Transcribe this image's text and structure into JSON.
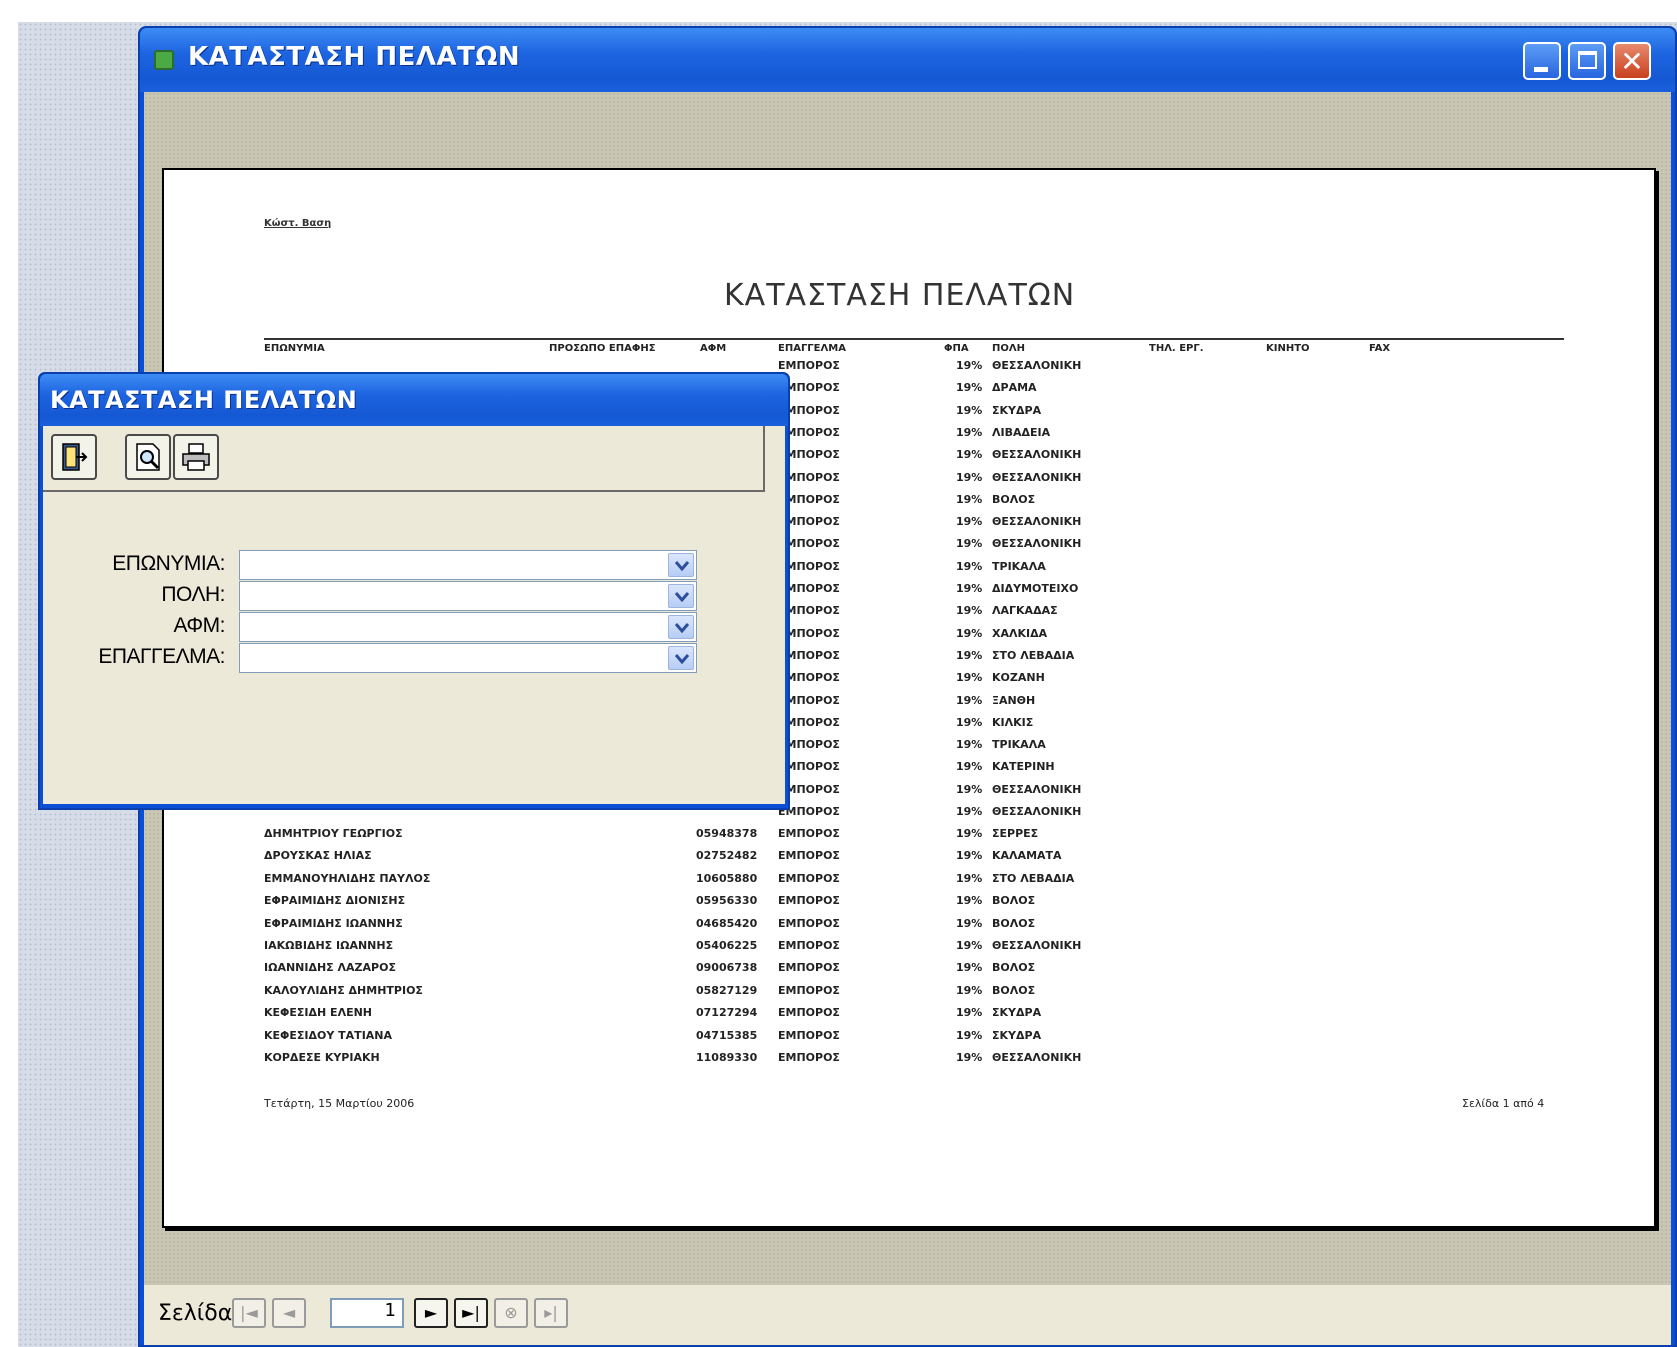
{
  "main_window": {
    "title": "ΚΑΤΑΣΤΑΣΗ ΠΕΛΑΤΩΝ",
    "controls": {
      "minimize": "minimize",
      "maximize": "maximize",
      "close": "✕"
    }
  },
  "report": {
    "tag": "Κώστ. Βαση",
    "title": "ΚΑΤΑΣΤΑΣΗ ΠΕΛΑΤΩΝ",
    "columns": [
      "ΕΠΩΝΥΜΙΑ",
      "ΠΡΟΣΩΠΟ ΕΠΑΦΗΣ",
      "ΑΦΜ",
      "ΕΠΑΓΓΕΛΜΑ",
      "ΦΠΑ",
      "ΠΟΛΗ",
      "ΤΗΛ. ΕΡΓ.",
      "ΚΙΝΗΤΟ",
      "FAX"
    ],
    "rows_visible_behind_dialog": [
      {
        "epaggelma": "ΕΜΠΟΡΟΣ",
        "fpa": "19%",
        "poli": "ΘΕΣΣΑΛΟΝΙΚΗ"
      },
      {
        "epaggelma": "ΕΜΠΟΡΟΣ",
        "fpa": "19%",
        "poli": "ΔΡΑΜΑ"
      },
      {
        "epaggelma": "ΕΜΠΟΡΟΣ",
        "fpa": "19%",
        "poli": "ΣΚΥΔΡΑ"
      },
      {
        "epaggelma": "ΕΜΠΟΡΟΣ",
        "fpa": "19%",
        "poli": "ΛΙΒΑΔΕΙΑ"
      },
      {
        "epaggelma": "ΕΜΠΟΡΟΣ",
        "fpa": "19%",
        "poli": "ΘΕΣΣΑΛΟΝΙΚΗ"
      },
      {
        "epaggelma": "ΕΜΠΟΡΟΣ",
        "fpa": "19%",
        "poli": "ΘΕΣΣΑΛΟΝΙΚΗ"
      },
      {
        "epaggelma": "ΕΜΠΟΡΟΣ",
        "fpa": "19%",
        "poli": "ΒΟΛΟΣ"
      },
      {
        "epaggelma": "ΕΜΠΟΡΟΣ",
        "fpa": "19%",
        "poli": "ΘΕΣΣΑΛΟΝΙΚΗ"
      },
      {
        "epaggelma": "ΕΜΠΟΡΟΣ",
        "fpa": "19%",
        "poli": "ΘΕΣΣΑΛΟΝΙΚΗ"
      },
      {
        "epaggelma": "ΕΜΠΟΡΟΣ",
        "fpa": "19%",
        "poli": "ΤΡΙΚΑΛΑ"
      },
      {
        "epaggelma": "ΕΜΠΟΡΟΣ",
        "fpa": "19%",
        "poli": "ΔΙΔΥΜΟΤΕΙΧΟ"
      },
      {
        "epaggelma": "ΕΜΠΟΡΟΣ",
        "fpa": "19%",
        "poli": "ΛΑΓΚΑΔΑΣ"
      },
      {
        "epaggelma": "ΕΜΠΟΡΟΣ",
        "fpa": "19%",
        "poli": "ΧΑΛΚΙΔΑ"
      },
      {
        "epaggelma": "ΕΜΠΟΡΟΣ",
        "fpa": "19%",
        "poli": "ΣΤΟ ΛΕΒΑΔΙΑ"
      },
      {
        "epaggelma": "ΕΜΠΟΡΟΣ",
        "fpa": "19%",
        "poli": "ΚΟΖΑΝΗ"
      },
      {
        "epaggelma": "ΕΜΠΟΡΟΣ",
        "fpa": "19%",
        "poli": "ΞΑΝΘΗ"
      },
      {
        "epaggelma": "ΕΜΠΟΡΟΣ",
        "fpa": "19%",
        "poli": "ΚΙΛΚΙΣ"
      },
      {
        "epaggelma": "ΕΜΠΟΡΟΣ",
        "fpa": "19%",
        "poli": "ΤΡΙΚΑΛΑ"
      },
      {
        "epaggelma": "ΕΜΠΟΡΟΣ",
        "fpa": "19%",
        "poli": "ΚΑΤΕΡΙΝΗ"
      },
      {
        "epaggelma": "ΕΜΠΟΡΟΣ",
        "fpa": "19%",
        "poli": "ΘΕΣΣΑΛΟΝΙΚΗ"
      },
      {
        "epaggelma": "ΕΜΠΟΡΟΣ",
        "fpa": "19%",
        "poli": "ΘΕΣΣΑΛΟΝΙΚΗ"
      }
    ],
    "rows_full": [
      {
        "eponymia": "ΔΗΜΗΤΡΙΟΥ ΓΕΩΡΓΙΟΣ",
        "afm": "05948378",
        "epaggelma": "ΕΜΠΟΡΟΣ",
        "fpa": "19%",
        "poli": "ΣΕΡΡΕΣ"
      },
      {
        "eponymia": "ΔΡΟΥΣΚΑΣ ΗΛΙΑΣ",
        "afm": "02752482",
        "epaggelma": "ΕΜΠΟΡΟΣ",
        "fpa": "19%",
        "poli": "ΚΑΛΑΜΑΤΑ"
      },
      {
        "eponymia": "ΕΜΜΑΝΟΥΗΛΙΔΗΣ ΠΑΥΛΟΣ",
        "afm": "10605880",
        "epaggelma": "ΕΜΠΟΡΟΣ",
        "fpa": "19%",
        "poli": "ΣΤΟ ΛΕΒΑΔΙΑ"
      },
      {
        "eponymia": "ΕΦΡΑΙΜΙΔΗΣ ΔΙΟΝΙΣΗΣ",
        "afm": "05956330",
        "epaggelma": "ΕΜΠΟΡΟΣ",
        "fpa": "19%",
        "poli": "ΒΟΛΟΣ"
      },
      {
        "eponymia": "ΕΦΡΑΙΜΙΔΗΣ ΙΩΑΝΝΗΣ",
        "afm": "04685420",
        "epaggelma": "ΕΜΠΟΡΟΣ",
        "fpa": "19%",
        "poli": "ΒΟΛΟΣ"
      },
      {
        "eponymia": "ΙΑΚΩΒΙΔΗΣ ΙΩΑΝΝΗΣ",
        "afm": "05406225",
        "epaggelma": "ΕΜΠΟΡΟΣ",
        "fpa": "19%",
        "poli": "ΘΕΣΣΑΛΟΝΙΚΗ"
      },
      {
        "eponymia": "ΙΩΑΝΝΙΔΗΣ ΛΑΖΑΡΟΣ",
        "afm": "09006738",
        "epaggelma": "ΕΜΠΟΡΟΣ",
        "fpa": "19%",
        "poli": "ΒΟΛΟΣ"
      },
      {
        "eponymia": "ΚΑΛΟΥΛΙΔΗΣ ΔΗΜΗΤΡΙΟΣ",
        "afm": "05827129",
        "epaggelma": "ΕΜΠΟΡΟΣ",
        "fpa": "19%",
        "poli": "ΒΟΛΟΣ"
      },
      {
        "eponymia": "ΚΕΦΕΣΙΔΗ ΕΛΕΝΗ",
        "afm": "07127294",
        "epaggelma": "ΕΜΠΟΡΟΣ",
        "fpa": "19%",
        "poli": "ΣΚΥΔΡΑ"
      },
      {
        "eponymia": "ΚΕΦΕΣΙΔΟΥ ΤΑΤΙΑΝΑ",
        "afm": "04715385",
        "epaggelma": "ΕΜΠΟΡΟΣ",
        "fpa": "19%",
        "poli": "ΣΚΥΔΡΑ"
      },
      {
        "eponymia": "ΚΟΡΔΕΣΕ ΚΥΡΙΑΚΗ",
        "afm": "11089330",
        "epaggelma": "ΕΜΠΟΡΟΣ",
        "fpa": "19%",
        "poli": "ΘΕΣΣΑΛΟΝΙΚΗ"
      }
    ],
    "footer_date": "Τετάρτη, 15 Μαρτίου 2006",
    "footer_page": "Σελίδα 1 από 4"
  },
  "navigation": {
    "label": "Σελίδα:",
    "page_value": "1",
    "first": "|◄",
    "prev": "◄",
    "next": "►",
    "last": "►|",
    "close_preview": "⊗",
    "print_preview": "▸|"
  },
  "dialog": {
    "title": "ΚΑΤΑΣΤΑΣΗ ΠΕΛΑΤΩΝ",
    "fields": {
      "eponymia": {
        "label": "ΕΠΩΝΥΜΙΑ:",
        "value": ""
      },
      "poli": {
        "label": "ΠΟΛΗ:",
        "value": ""
      },
      "afm": {
        "label": "ΑΦΜ:",
        "value": ""
      },
      "epaggelma": {
        "label": "ΕΠΑΓΓΕΛΜΑ:",
        "value": ""
      }
    },
    "toolbar": {
      "exit": "exit-icon",
      "preview": "print-preview-icon",
      "print": "print-icon"
    }
  },
  "colors": {
    "titlebar": "#1d64e0",
    "window_bg": "#ece9d8",
    "client_bg": "#c9c6b4"
  }
}
